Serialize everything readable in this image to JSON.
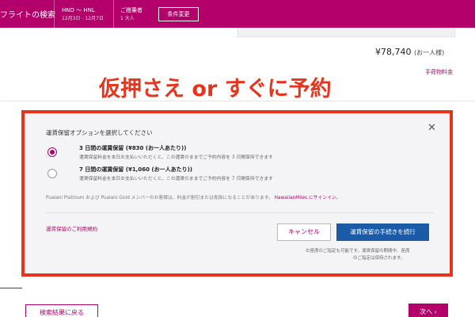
{
  "header": {
    "title": "フライトの検索",
    "route": "HND 〜 HNL",
    "dates": "12月3日 - 12月7日",
    "passengers_label": "ご搭乗者",
    "passengers_value": "1 大人",
    "change_button": "条件変更"
  },
  "summary": {
    "price": "¥78,740",
    "price_unit": "(お一人様)",
    "baggage_link": "手荷物料金"
  },
  "annotation": {
    "text": "仮押さえ or すぐに予約",
    "color": "#e8341c"
  },
  "modal": {
    "heading": "運賃保留オプションを選択してください",
    "close_icon": "close-icon",
    "options": [
      {
        "title": "3 日間の運賃保留 (¥830 (お一人あたり))",
        "description": "運賃保留料金を本日お支払いいただくと、この運賃のままでご予約内容を 3 日間保持できます",
        "selected": true
      },
      {
        "title": "7 日間の運賃保留 (¥1,060 (お一人あたり))",
        "description": "運賃保留料金を本日お支払いいただくと、この運賃のままでご予約内容を 7 日間保持できます",
        "selected": false
      }
    ],
    "member_note": "Pualani Platinum および Pualani Gold メンバーのお客様は、料金が割引または免除になることがあります。",
    "member_link": "HawaiianMiles にサインイン。",
    "terms_link": "運賃保留のご利用規約",
    "cancel_button": "キャンセル",
    "continue_button": "運賃保留の手続きを続行",
    "footnote_line1": "お座席のご指定も可能です。運賃保留の期間中、座席",
    "footnote_line2": "のご指定は保持されます。"
  },
  "footer": {
    "back_button": "検索結果に戻る",
    "next_button": "次へ ›"
  },
  "colors": {
    "brand": "#b3006b",
    "primary_button": "#1a5aa6",
    "highlight": "#e8341c"
  }
}
